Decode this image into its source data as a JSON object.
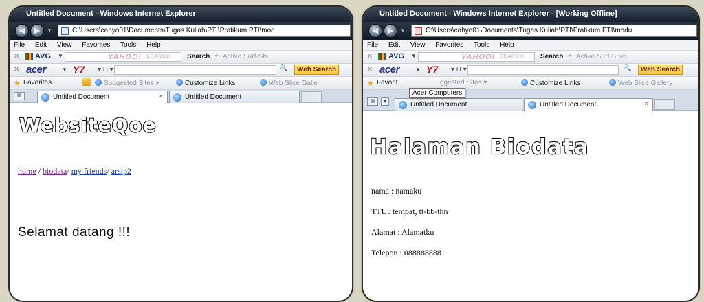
{
  "left": {
    "window_title": "Untitled Document - Windows Internet Explorer",
    "address": "C:\\Users\\cahyo01\\Documents\\Tugas Kuliah\\PTI\\Pratikum PTI\\mod",
    "menu": [
      "File",
      "Edit",
      "View",
      "Favorites",
      "Tools",
      "Help"
    ],
    "toolbar1": {
      "avg": "AVG",
      "yahoo": "YAHOO!",
      "yahoo_search": "SEARCH",
      "search": "Search",
      "active": "Active Surf-Shi"
    },
    "toolbar2": {
      "acer": "acer",
      "y7": "Y7",
      "web_search": "Web Search"
    },
    "favbar": {
      "favorites": "Favorites",
      "suggested": "Suggested Sites",
      "customize": "Customize Links",
      "slice": "Web Slice Galle"
    },
    "tabs": [
      {
        "label": "Untitled Document",
        "close": "×"
      },
      {
        "label": "Untitled Document"
      }
    ],
    "page": {
      "logo": "WebsiteQoe",
      "nav": {
        "home": "home",
        "biodata": "biodata",
        "friends": "my friends",
        "arsip": "arsip2"
      },
      "welcome": "Selamat datang !!!"
    }
  },
  "right": {
    "window_title": "Untitled Document - Windows Internet Explorer - [Working Offline]",
    "address": "C:\\Users\\cahyo01\\Documents\\Tugas Kuliah\\PTI\\Pratikum PTI\\modu",
    "menu": [
      "File",
      "Edit",
      "View",
      "Favorites",
      "Tools",
      "Help"
    ],
    "toolbar1": {
      "avg": "AVG",
      "yahoo": "YAHOO!",
      "yahoo_search": "SEARCH",
      "search": "Search",
      "active": "Active Surf-Shiel"
    },
    "toolbar2": {
      "acer": "acer",
      "y7": "Y7",
      "web_search": "Web Search"
    },
    "favbar": {
      "favorites": "Favorit",
      "suggested": "ggested Sites",
      "customize": "Customize Links",
      "slice": "Web Slice Gallery"
    },
    "tooltip": "Acer Computers",
    "tabs": [
      {
        "label": "Untitled Document"
      },
      {
        "label": "Untitled Document",
        "close": "×"
      }
    ],
    "page": {
      "title": "Halaman Biodata",
      "lines": [
        "nama : namaku",
        "TTL : tempat, tt-bb-thn",
        "Alamat : Alamatku",
        "Telepon : 088888888"
      ]
    }
  }
}
